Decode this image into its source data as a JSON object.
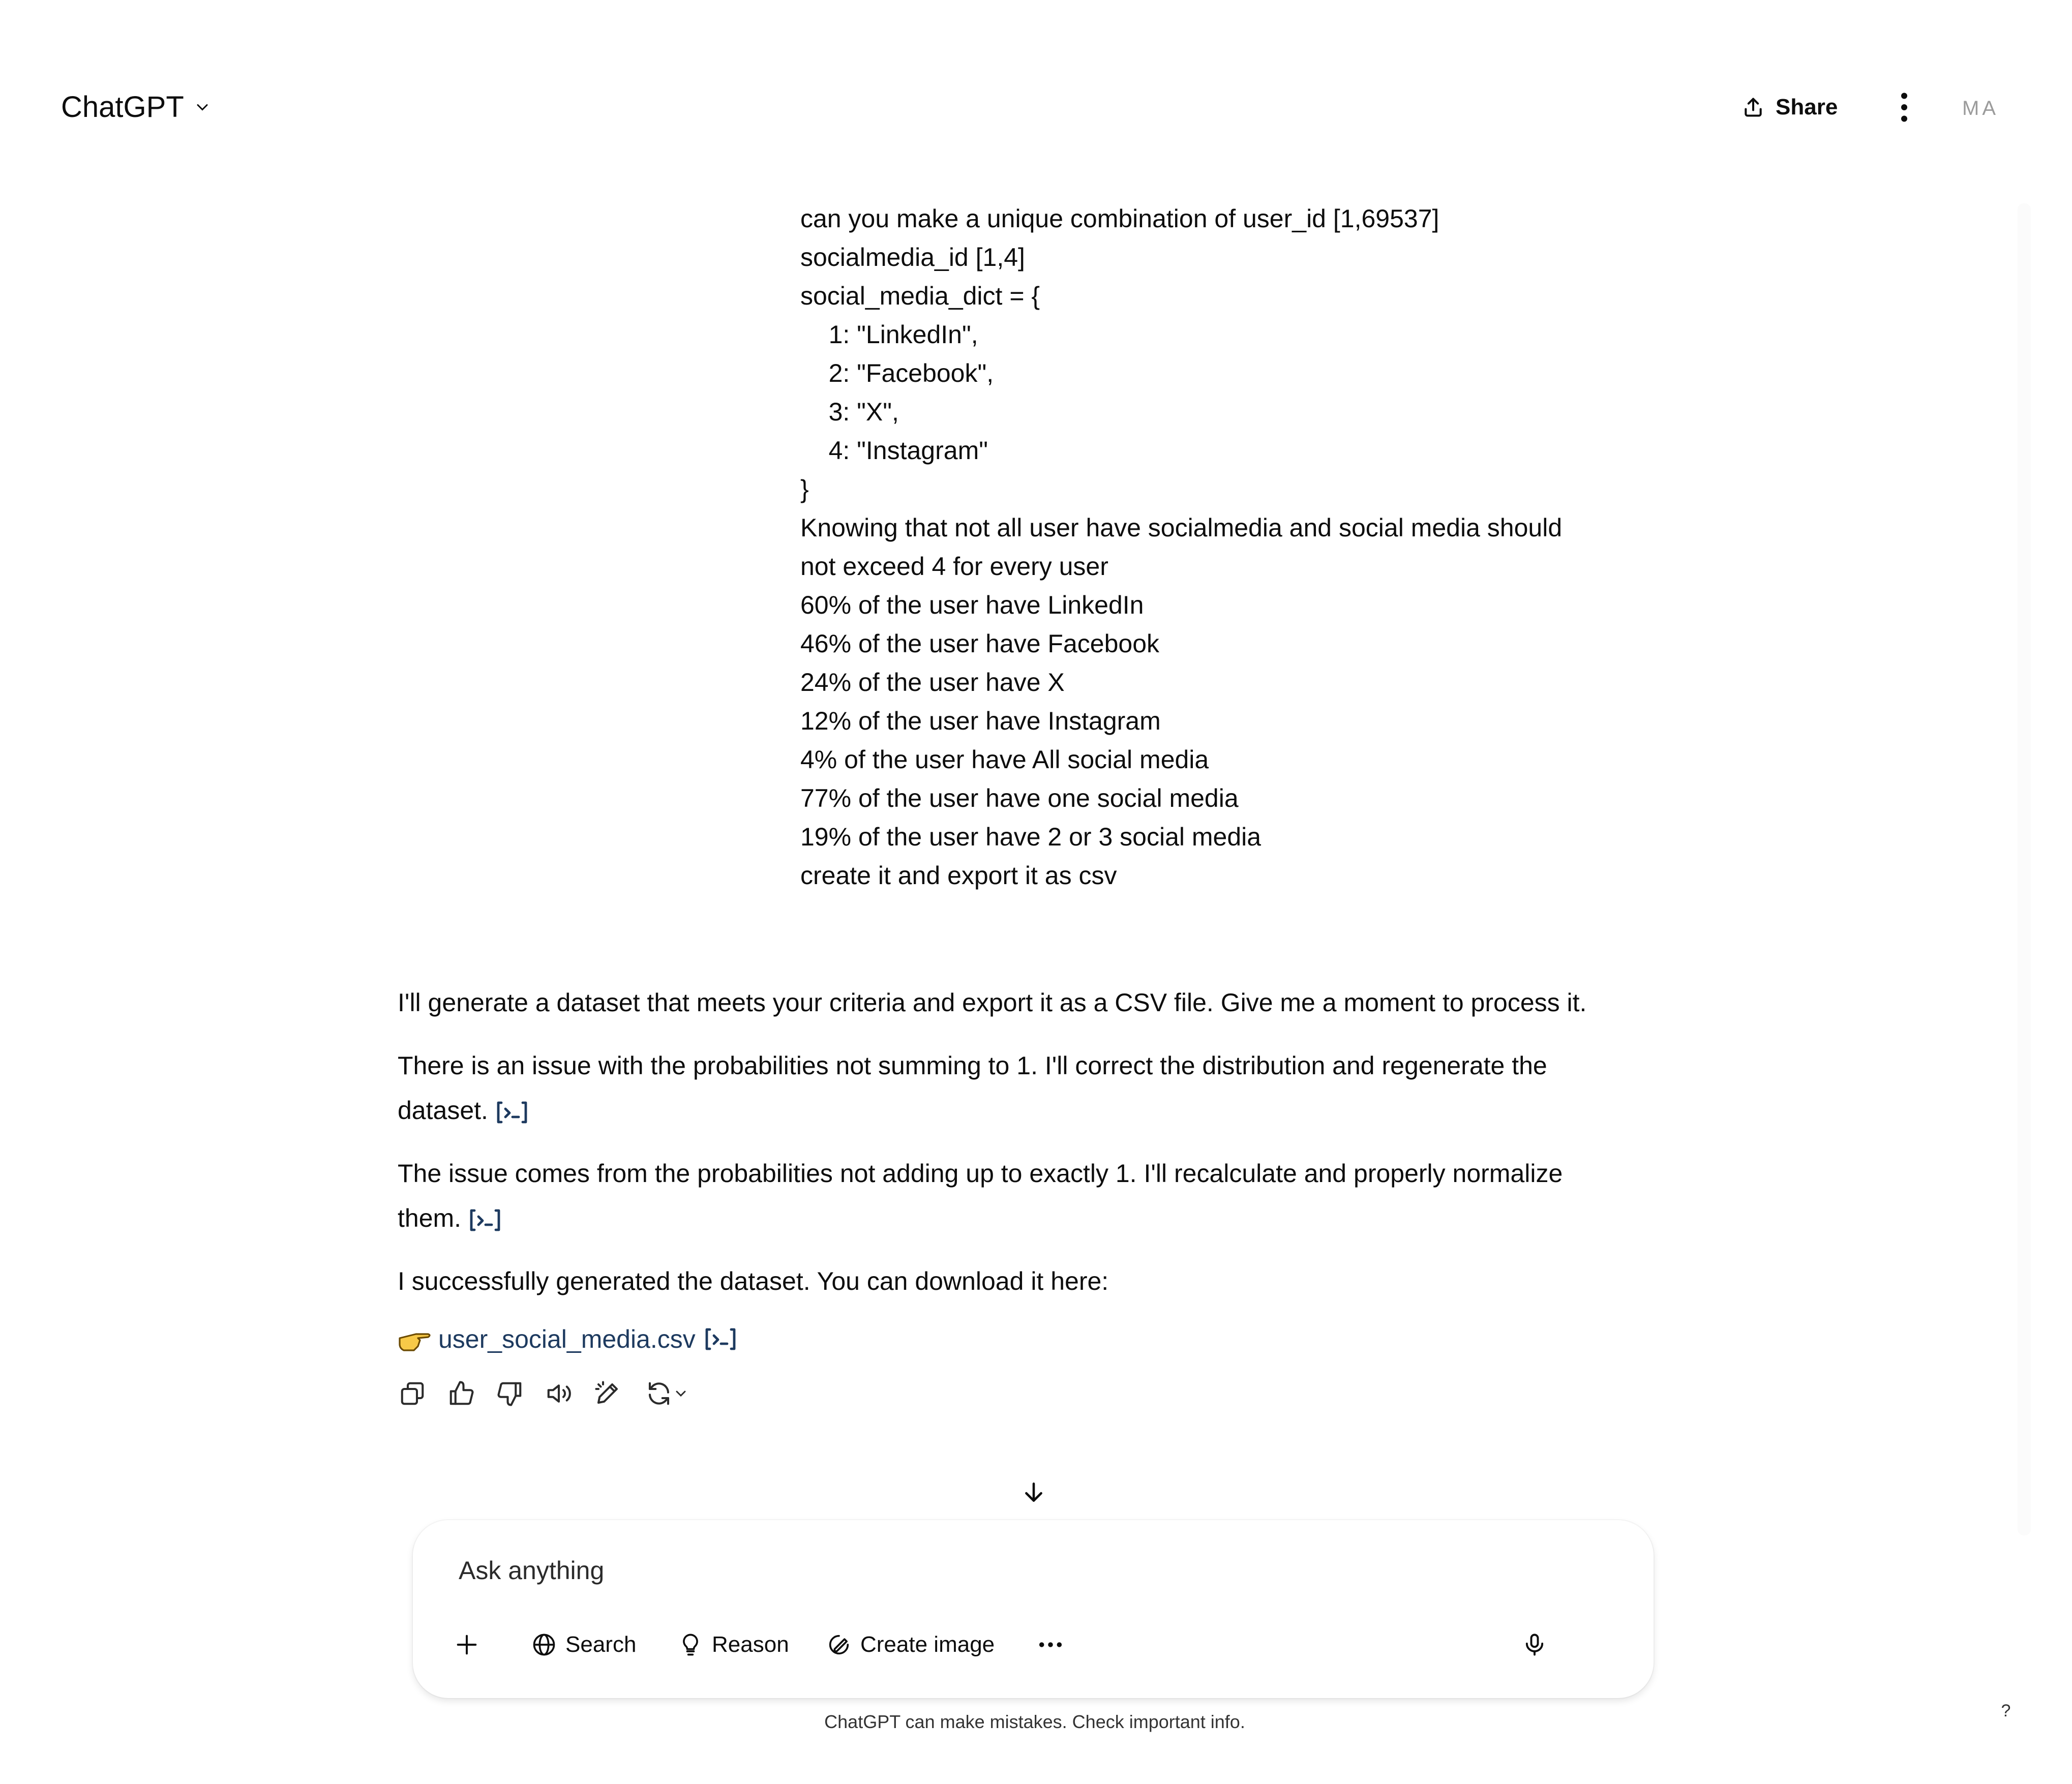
{
  "header": {
    "title": "ChatGPT",
    "share_label": "Share",
    "avatar_initials": "MA"
  },
  "user_message": {
    "lines": [
      "can you make a unique combination of user_id [1,69537]",
      "socialmedia_id [1,4]",
      "social_media_dict = {",
      "    1: \"LinkedIn\",",
      "    2: \"Facebook\",",
      "    3: \"X\",",
      "    4: \"Instagram\"",
      "}",
      "Knowing that not all user have socialmedia and social media should",
      "not exceed 4 for every user",
      "60% of the user have LinkedIn",
      "46% of the user have Facebook",
      "24% of the user have X",
      "12% of the user have Instagram",
      "4% of the user have All social media",
      "77% of the user have one social media",
      "19% of the user have 2 or 3 social media",
      "create it and export it as csv"
    ]
  },
  "assistant": {
    "p1": "I'll generate a dataset that meets your criteria and export it as a CSV file. Give me a moment to process it.",
    "p2": "There is an issue with the probabilities not summing to 1. I'll correct the distribution and regenerate the dataset.",
    "p3": "The issue comes from the probabilities not adding up to exactly 1. I'll recalculate and properly normalize them.",
    "p4": "I successfully generated the dataset. You can download it here:",
    "file_link": "user_social_media.csv"
  },
  "composer": {
    "placeholder": "Ask anything",
    "tools": {
      "search": "Search",
      "reason": "Reason",
      "create_image": "Create image"
    }
  },
  "footer": {
    "disclaimer": "ChatGPT can make mistakes. Check important info.",
    "help": "?"
  },
  "colors": {
    "accent_link": "#1d3a5f",
    "text": "#0d0d0d",
    "muted": "#9b9b9b"
  }
}
